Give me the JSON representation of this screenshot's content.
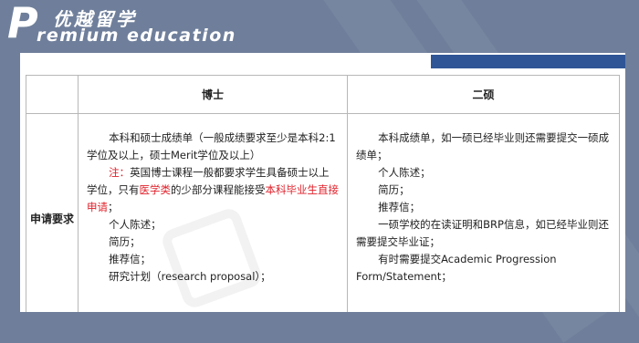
{
  "header": {
    "logo_letter": "P",
    "logo_cn": "优越留学",
    "logo_en": "remium education"
  },
  "table": {
    "col_header_label": "",
    "col_phd": "博士",
    "col_master2": "二硕",
    "row_label": "申请要求",
    "phd": {
      "transcript": "本科和硕士成绩单（一般成绩要求至少是本科2:1学位及以上，硕士Merit学位及以上）",
      "note_prefix": "注：",
      "note_text_1": "英国博士课程一般都要求学生具备硕士以上学位，只有",
      "note_red_1": "医学类",
      "note_text_2": "的少部分课程能接受",
      "note_red_2": "本科毕业生直接申请",
      "note_text_3": "；",
      "statement": "个人陈述；",
      "cv": "简历；",
      "reference": "推荐信；",
      "proposal": "研究计划（research proposal）；"
    },
    "master2": {
      "transcript": "本科成绩单，如一硕已经毕业则还需要提交一硕成绩单；",
      "statement": "个人陈述；",
      "cv": "简历；",
      "reference": "推荐信；",
      "enrollment": "一硕学校的在读证明和BRP信息，如已经毕业则还需要提交毕业证；",
      "progression": "有时需要提交Academic Progression Form/Statement；"
    }
  },
  "colors": {
    "background": "#6f7f9b",
    "accent_bar": "#2f5596",
    "highlight": "#e0202a"
  }
}
